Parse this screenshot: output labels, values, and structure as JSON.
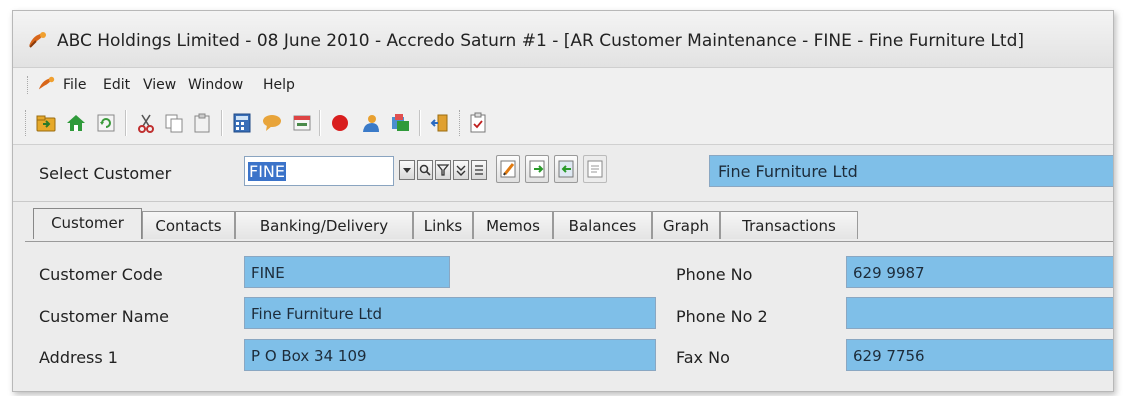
{
  "window": {
    "title": "ABC Holdings Limited - 08 June 2010 - Accredo Saturn #1 - [AR Customer Maintenance - FINE - Fine Furniture Ltd]"
  },
  "menu": [
    {
      "label": "File"
    },
    {
      "label": "Edit"
    },
    {
      "label": "View"
    },
    {
      "label": "Window"
    },
    {
      "label": "Help"
    }
  ],
  "toolbar_icons": [
    "open-folder-icon",
    "home-icon",
    "refresh-icon",
    "cut-icon",
    "copy-icon",
    "paste-icon",
    "calculator-icon",
    "chat-icon",
    "window-icon",
    "stop-icon",
    "user-icon",
    "stack-icon",
    "exit-door-icon",
    "checklist-icon"
  ],
  "select_customer": {
    "label": "Select Customer",
    "value": "FINE",
    "display_name": "Fine Furniture Ltd",
    "buttons": [
      "dropdown-icon",
      "search-icon",
      "filter-icon",
      "expand-icon",
      "edit-icon",
      "note-icon",
      "export-icon",
      "import-icon",
      "document-icon"
    ]
  },
  "tabs": [
    {
      "label": "Customer",
      "active": true
    },
    {
      "label": "Contacts"
    },
    {
      "label": "Banking/Delivery"
    },
    {
      "label": "Links"
    },
    {
      "label": "Memos"
    },
    {
      "label": "Balances"
    },
    {
      "label": "Graph"
    },
    {
      "label": "Transactions"
    }
  ],
  "form": {
    "customer_code": {
      "label": "Customer Code",
      "value": "FINE"
    },
    "customer_name": {
      "label": "Customer Name",
      "value": "Fine Furniture Ltd"
    },
    "address_1": {
      "label": "Address 1",
      "value": "P O Box 34 109"
    },
    "phone_no": {
      "label": "Phone No",
      "value": "629 9987"
    },
    "phone_no_2": {
      "label": "Phone No 2",
      "value": ""
    },
    "fax_no": {
      "label": "Fax No",
      "value": "629 7756"
    }
  },
  "colors": {
    "field_background": "#7fbfe8",
    "selection": "#3b73c9",
    "window_background": "#ececec"
  }
}
